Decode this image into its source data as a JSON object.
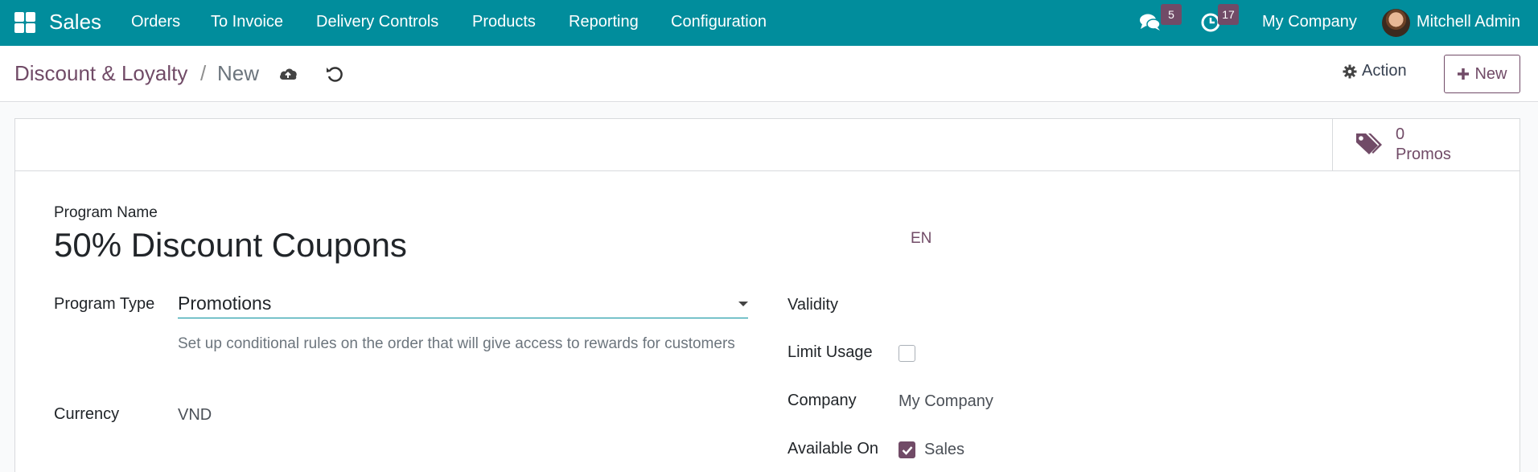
{
  "navbar": {
    "app_name": "Sales",
    "menu": [
      "Orders",
      "To Invoice",
      "Delivery Controls",
      "Products",
      "Reporting",
      "Configuration"
    ],
    "messages_count": "5",
    "activities_count": "17",
    "company": "My Company",
    "user": "Mitchell Admin",
    "bg_color": "#018d9c",
    "badge_color": "#714b67"
  },
  "control_panel": {
    "breadcrumb_parent": "Discount & Loyalty",
    "breadcrumb_sep": "/",
    "breadcrumb_current": "New",
    "action_label": "Action",
    "new_label": "New"
  },
  "stat_button": {
    "value": "0",
    "label": "Promos",
    "icon": "tags-icon"
  },
  "form": {
    "program_name_label": "Program Name",
    "program_name_value": "50% Discount Coupons",
    "lang": "EN",
    "program_type_label": "Program Type",
    "program_type_value": "Promotions",
    "program_type_help": "Set up conditional rules on the order that will give access to rewards for customers",
    "currency_label": "Currency",
    "currency_value": "VND",
    "validity_label": "Validity",
    "limit_usage_label": "Limit Usage",
    "limit_usage_checked": false,
    "company_label": "Company",
    "company_value": "My Company",
    "available_on_label": "Available On",
    "available_on_option": "Sales",
    "available_on_checked": true
  }
}
